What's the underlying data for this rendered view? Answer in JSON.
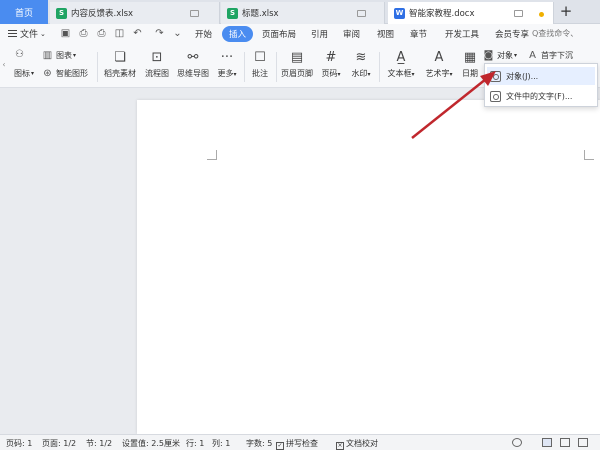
{
  "tabs": {
    "home": "首页",
    "items": [
      {
        "label": "内容反馈表.xlsx",
        "type": "xlsx",
        "icon": "S"
      },
      {
        "label": "标题.xlsx",
        "type": "xlsx",
        "icon": "S"
      },
      {
        "label": "智能家教程.docx",
        "type": "docx",
        "icon": "W"
      }
    ],
    "add": "+"
  },
  "menu": {
    "file": "文件",
    "items": [
      "开始",
      "插入",
      "页面布局",
      "引用",
      "审阅",
      "视图",
      "章节",
      "开发工具",
      "会员专享"
    ],
    "active": "插入",
    "search": "Q查找命令、"
  },
  "ribbon": {
    "shapes": "图标",
    "chart": "图表",
    "smart_graphic": "智能图形",
    "material": "稻壳素材",
    "flowchart": "流程图",
    "mindmap": "思维导图",
    "more": "更多",
    "comment": "批注",
    "header_footer": "页眉页脚",
    "page_number": "页码",
    "watermark": "水印",
    "textbox": "文本框",
    "wordart": "艺术字",
    "date": "日期",
    "object": "对象",
    "dropcap": "首字下沉"
  },
  "dropdown": {
    "items": [
      "对象(J)...",
      "文件中的文字(F)..."
    ]
  },
  "status": {
    "page_num": "页码: 1",
    "pages": "页面: 1/2",
    "section": "节: 1/2",
    "setting": "设置值: 2.5厘米",
    "row": "行: 1",
    "col": "列: 1",
    "words": "字数: 5",
    "spell": "拼写检查",
    "proof": "文档校对"
  },
  "colors": {
    "accent": "#4a8cf0",
    "arrow": "#c0272d"
  }
}
